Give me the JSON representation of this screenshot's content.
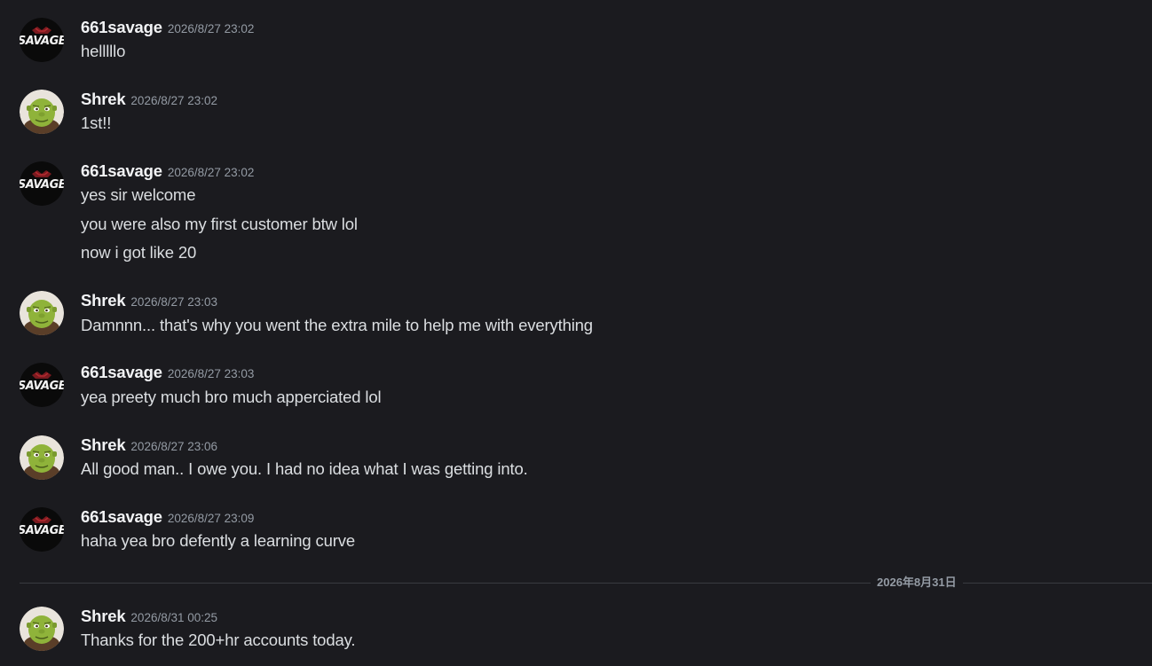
{
  "messages": [
    {
      "author": "661savage",
      "time": "2026/8/27 23:02",
      "lines": [
        "helllllo"
      ]
    },
    {
      "author": "Shrek",
      "time": "2026/8/27 23:02",
      "lines": [
        "1st!!"
      ]
    },
    {
      "author": "661savage",
      "time": "2026/8/27 23:02",
      "lines": [
        "yes sir welcome",
        "you were also my first customer btw lol",
        "now i got like 20"
      ]
    },
    {
      "author": "Shrek",
      "time": "2026/8/27 23:03",
      "lines": [
        "Damnnn... that's why you went the extra mile to help me with everything"
      ]
    },
    {
      "author": "661savage",
      "time": "2026/8/27 23:03",
      "lines": [
        "yea preety much bro much apperciated lol"
      ]
    },
    {
      "author": "Shrek",
      "time": "2026/8/27 23:06",
      "lines": [
        "All good man.. I owe you. I had no idea what I was getting into."
      ]
    },
    {
      "author": "661savage",
      "time": "2026/8/27 23:09",
      "lines": [
        "haha yea bro defently a learning curve"
      ]
    },
    {
      "author": "Shrek",
      "time": "2026/8/31 00:25",
      "lines": [
        "Thanks for the 200+hr accounts today."
      ]
    }
  ],
  "date_divider": "2026年8月31日",
  "avatar_text": {
    "savage": "SAVAGE"
  },
  "colors": {
    "background": "#1b1b1f",
    "username": "#f2f3f5",
    "timestamp": "#949ba4",
    "message_text": "#dbdee1",
    "savage_avatar_bg": "#0a0a0a",
    "shrek_skin": "#8fb33a"
  }
}
